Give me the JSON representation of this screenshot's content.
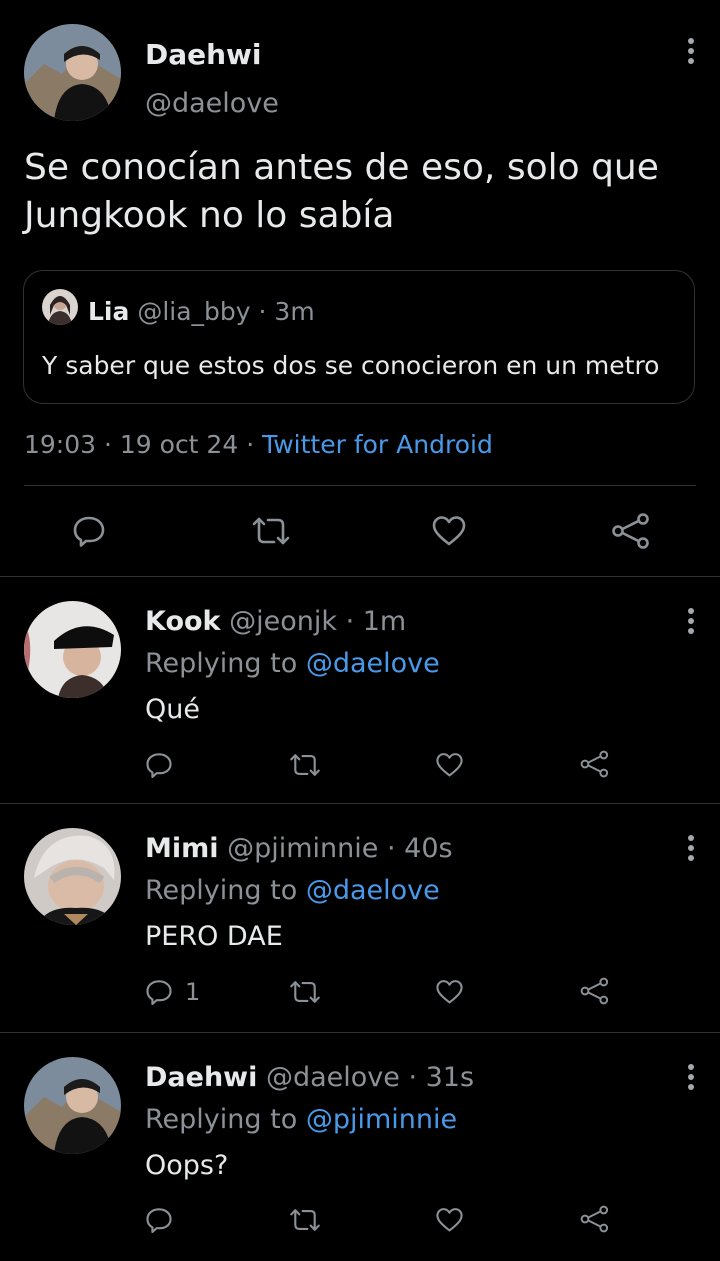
{
  "main_tweet": {
    "name": "Daehwi",
    "handle": "@daelove",
    "text_line1": "Se conocían antes de eso, solo que",
    "text_line2": "Jungkook no lo sabía",
    "quote": {
      "name": "Lia",
      "handle": "@lia_bby",
      "time": "· 3m",
      "text": "Y saber que estos dos se conocieron en un metro"
    },
    "timestamp": "19:03 · 19 oct 24 ·",
    "source": "Twitter for Android",
    "actions": [
      "reply-icon",
      "retweet-icon",
      "like-icon",
      "share-icon"
    ]
  },
  "replies": [
    {
      "name": "Kook",
      "handle": "@jeonjk",
      "time": "· 1m",
      "replying_label": "Replying to",
      "replying_to": "@daelove",
      "text": "Qué",
      "reply_count": ""
    },
    {
      "name": "Mimi",
      "handle": "@pjiminnie",
      "time": "· 40s",
      "replying_label": "Replying to",
      "replying_to": "@daelove",
      "text": "PERO DAE",
      "reply_count": "1"
    },
    {
      "name": "Daehwi",
      "handle": "@daelove",
      "time": "· 31s",
      "replying_label": "Replying to",
      "replying_to": "@pjiminnie",
      "text": "Oops?",
      "reply_count": ""
    }
  ],
  "colors": {
    "background": "#000000",
    "link": "#4a99e9",
    "muted": "#8b9196",
    "divider": "#2f3336"
  }
}
